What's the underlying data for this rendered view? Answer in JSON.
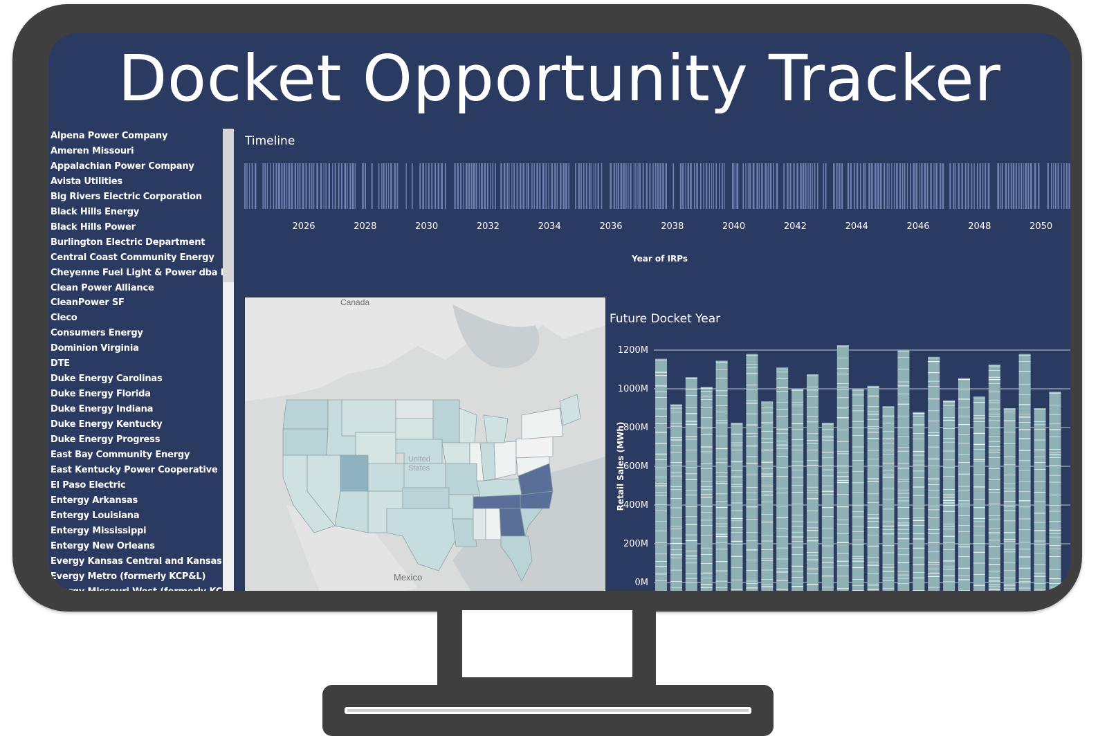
{
  "app": {
    "title": "Docket Opportunity Tracker"
  },
  "sidebar": {
    "items": [
      "Alpena Power Company",
      "Ameren Missouri",
      "Appalachian Power Company",
      "Avista Utilities",
      "Big Rivers Electric Corporation",
      "Black Hills Energy",
      "Black Hills Power",
      "Burlington Electric Department",
      "Central Coast Community Energy",
      "Cheyenne Fuel Light & Power dba Black H",
      "Clean Power Alliance",
      "CleanPower SF",
      "Cleco",
      "Consumers Energy",
      "Dominion Virginia",
      "DTE",
      "Duke Energy Carolinas",
      "Duke Energy Florida",
      "Duke Energy Indiana",
      "Duke Energy Kentucky",
      "Duke Energy Progress",
      "East Bay Community Energy",
      "East Kentucky Power Cooperative",
      "El Paso Electric",
      "Entergy Arkansas",
      "Entergy Louisiana",
      "Entergy Mississippi",
      "Entergy New Orleans",
      "Evergy Kansas Central and Kansas South",
      "Evergy Metro (formerly KCP&L)",
      "Evergy Missouri West (formerly KCP&L G"
    ]
  },
  "timeline": {
    "title": "Timeline",
    "axis_title": "Year of IRPs",
    "ticks": [
      "2026",
      "2028",
      "2030",
      "2032",
      "2034",
      "2036",
      "2038",
      "2040",
      "2042",
      "2044",
      "2046",
      "2048",
      "2050"
    ],
    "bar_color": "#6f7fb0"
  },
  "map": {
    "labels": {
      "canada": "Canada",
      "united_states": "United States",
      "mexico": "Mexico"
    }
  },
  "chart_data": {
    "type": "bar",
    "title": "Future Docket Year",
    "ylabel": "Retail Sales (MWh)",
    "xlabel": "",
    "ylim": [
      0,
      1200
    ],
    "yticks": [
      "0M",
      "200M",
      "400M",
      "600M",
      "800M",
      "1000M",
      "1200M"
    ],
    "values": [
      1155,
      920,
      1060,
      1010,
      1145,
      825,
      1180,
      935,
      1110,
      1000,
      1075,
      825,
      1225,
      1000,
      1015,
      910,
      1200,
      880,
      1165,
      940,
      1055,
      960,
      1125,
      900,
      1180,
      900,
      985
    ],
    "grid": true,
    "bar_color": "#8fb0b4"
  },
  "colors": {
    "screen_bg": "#2b3a60",
    "frame": "#3f3f3f"
  }
}
